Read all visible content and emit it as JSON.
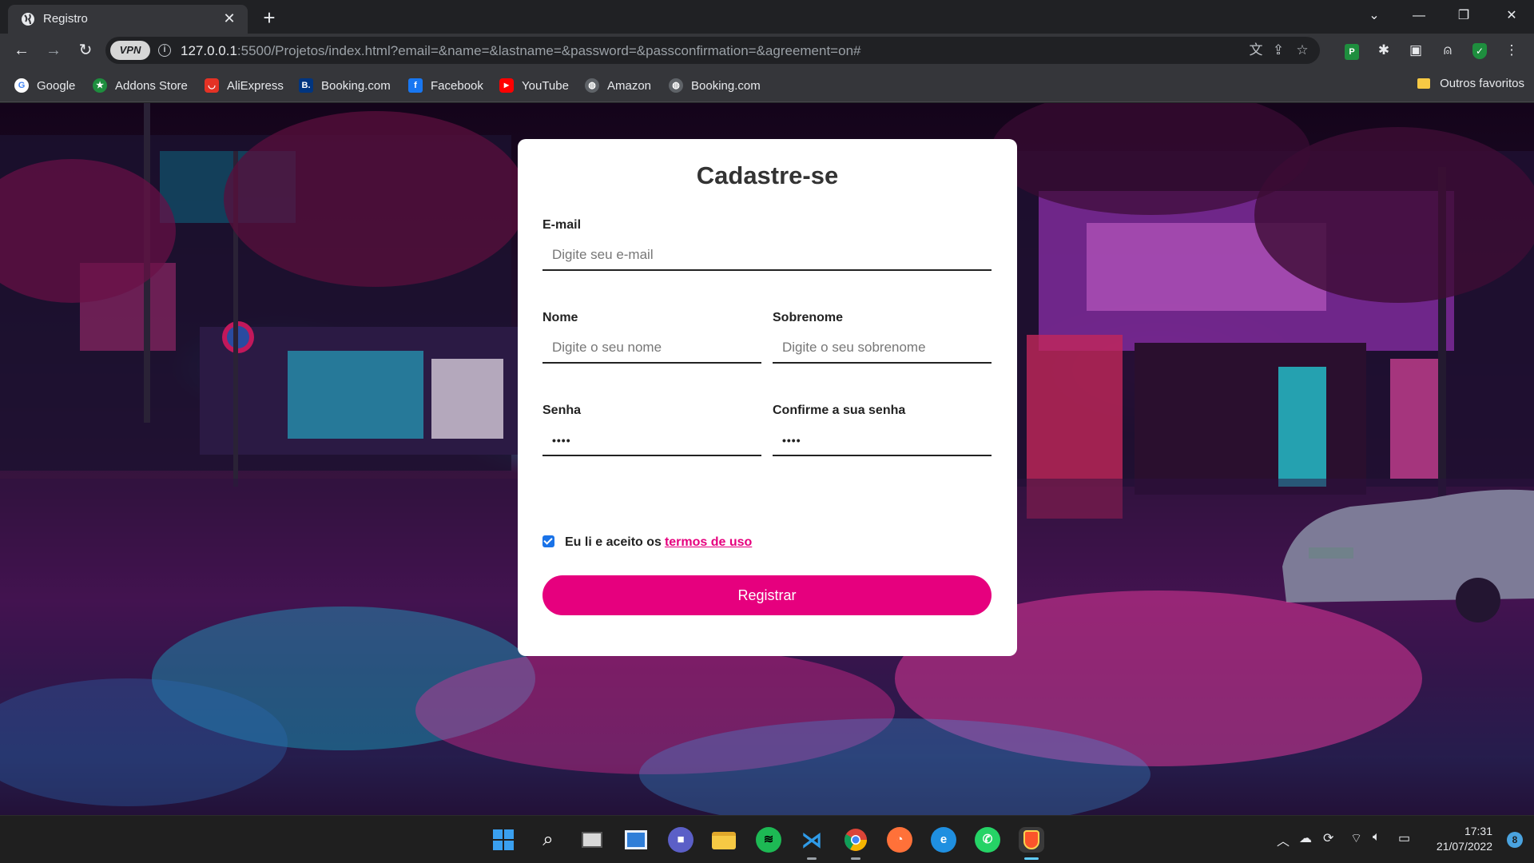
{
  "browser": {
    "tab": {
      "title": "Registro",
      "close": "✕"
    },
    "new_tab": "+",
    "window_controls": {
      "tabsearch": "⌄",
      "minimize": "—",
      "restore": "❐",
      "close": "✕"
    },
    "nav": {
      "back": "←",
      "forward": "→",
      "reload": "↻"
    },
    "vpn_label": "VPN",
    "url_host": "127.0.0.1",
    "url_path": ":5500/Projetos/index.html?email=&name=&lastname=&password=&passconfirmation=&agreement=on#",
    "icons": [
      "translate-icon",
      "share-icon",
      "star-icon",
      "extension-p-icon",
      "puzzle-icon",
      "sidepanel-icon",
      "profile-icon",
      "shield-icon",
      "menu-icon"
    ]
  },
  "bookmarks": {
    "items": [
      {
        "label": "Google",
        "icon": "google-icon",
        "color": "#ffffff"
      },
      {
        "label": "Addons Store",
        "icon": "addons-icon",
        "color": "#1e8e3e"
      },
      {
        "label": "AliExpress",
        "icon": "aliexpress-icon",
        "color": "#e43225"
      },
      {
        "label": "Booking.com",
        "icon": "booking-icon",
        "color": "#003580"
      },
      {
        "label": "Facebook",
        "icon": "facebook-icon",
        "color": "#1877f2"
      },
      {
        "label": "YouTube",
        "icon": "youtube-icon",
        "color": "#ff0000"
      },
      {
        "label": "Amazon",
        "icon": "globe-icon",
        "color": "#9aa0a6"
      },
      {
        "label": "Booking.com",
        "icon": "globe-icon",
        "color": "#9aa0a6"
      }
    ],
    "other_folder": "Outros favoritos"
  },
  "form": {
    "title": "Cadastre-se",
    "email": {
      "label": "E-mail",
      "placeholder": "Digite seu e-mail"
    },
    "name": {
      "label": "Nome",
      "placeholder": "Digite o seu nome"
    },
    "lastname": {
      "label": "Sobrenome",
      "placeholder": "Digite o seu sobrenome"
    },
    "password": {
      "label": "Senha",
      "value": "••••"
    },
    "password_confirm": {
      "label": "Confirme a sua senha",
      "value": "••••"
    },
    "agreement": {
      "text": "Eu li e aceito os",
      "link": "termos de uso",
      "checked": true
    },
    "submit": "Registrar",
    "accent_color": "#e6007e"
  },
  "taskbar": {
    "apps": [
      "windows-start-icon",
      "search-icon",
      "task-view-icon",
      "widgets-icon",
      "teams-chat-icon",
      "file-explorer-icon",
      "spotify-icon",
      "vscode-icon",
      "chrome-icon",
      "firefox-icon",
      "edge-icon",
      "whatsapp-icon",
      "brave-icon"
    ],
    "time": "17:31",
    "date": "21/07/2022",
    "notifications": "8"
  }
}
